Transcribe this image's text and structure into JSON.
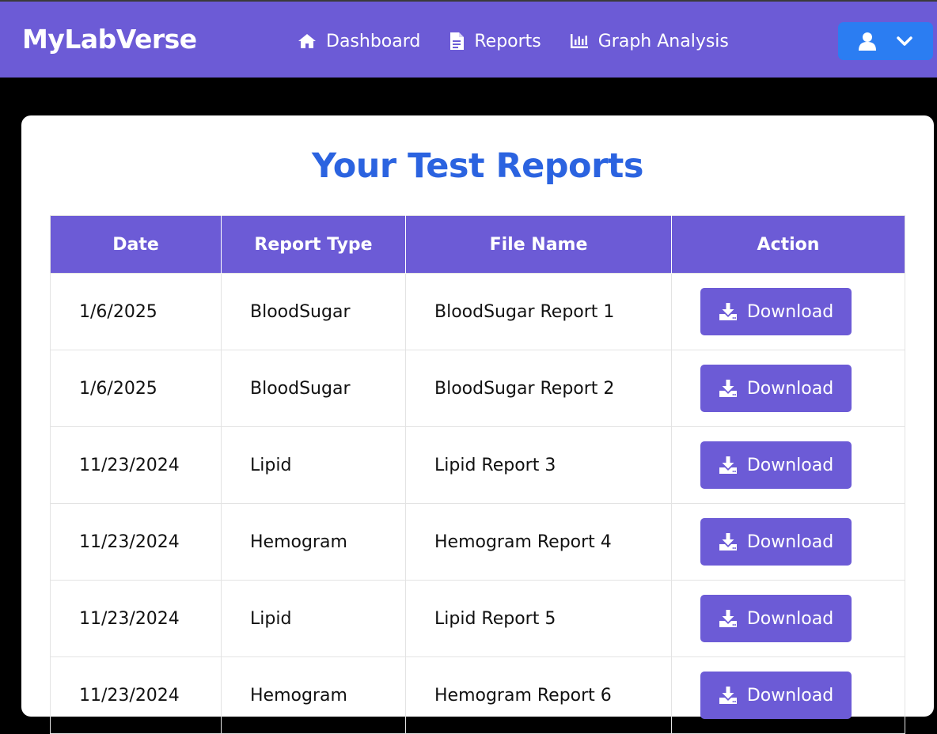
{
  "navbar": {
    "brand": "MyLabVerse",
    "links": [
      {
        "label": "Dashboard",
        "icon": "home-icon"
      },
      {
        "label": "Reports",
        "icon": "file-icon"
      },
      {
        "label": "Graph Analysis",
        "icon": "chart-bar-icon"
      }
    ],
    "user_menu": {
      "icons": [
        "user-icon",
        "chevron-down-icon"
      ]
    }
  },
  "colors": {
    "primary": "#6c5bd6",
    "title": "#2b63e0",
    "user_button": "#2b7df2"
  },
  "main": {
    "title": "Your Test Reports",
    "table": {
      "headers": [
        "Date",
        "Report Type",
        "File Name",
        "Action"
      ],
      "rows": [
        {
          "date": "1/6/2025",
          "type": "BloodSugar",
          "file": "BloodSugar Report 1",
          "action": "Download"
        },
        {
          "date": "1/6/2025",
          "type": "BloodSugar",
          "file": "BloodSugar Report 2",
          "action": "Download"
        },
        {
          "date": "11/23/2024",
          "type": "Lipid",
          "file": "Lipid Report 3",
          "action": "Download"
        },
        {
          "date": "11/23/2024",
          "type": "Hemogram",
          "file": "Hemogram Report 4",
          "action": "Download"
        },
        {
          "date": "11/23/2024",
          "type": "Lipid",
          "file": "Lipid Report 5",
          "action": "Download"
        },
        {
          "date": "11/23/2024",
          "type": "Hemogram",
          "file": "Hemogram Report 6",
          "action": "Download"
        }
      ]
    }
  }
}
